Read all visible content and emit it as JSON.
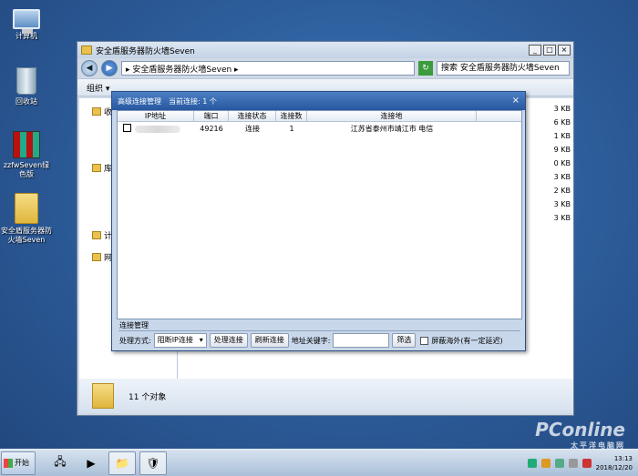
{
  "desktop": {
    "icons": [
      {
        "label": "计算机"
      },
      {
        "label": "回收站"
      },
      {
        "label": "zzfwSeven绿色版"
      },
      {
        "label": "安全盾服务器防火墙Seven"
      }
    ]
  },
  "explorer": {
    "title": "安全盾服务器防火墙Seven",
    "address": "▸ 安全盾服务器防火墙Seven ▸",
    "search_placeholder": "搜索 安全盾服务器防火墙Seven",
    "organize": "组织 ▾",
    "nav_items": [
      "收",
      "库",
      "计",
      "网"
    ],
    "sizes": [
      "3 KB",
      "6 KB",
      "1 KB",
      "9 KB",
      "0 KB",
      "3 KB",
      "2 KB",
      "3 KB",
      "3 KB"
    ],
    "status": "11 个对象"
  },
  "dialog": {
    "title": "高级连接管理",
    "connections_label": "当前连接: 1 个",
    "close": "×",
    "columns": [
      "IP地址",
      "端口",
      "连接状态",
      "连接数",
      "连接地"
    ],
    "rows": [
      {
        "port": "49216",
        "status": "连接",
        "count": "1",
        "location": "江苏省泰州市靖江市 电信"
      }
    ],
    "mgmt_label": "连接管理",
    "mode_label": "处理方式:",
    "mode_value": "阻断IP连接",
    "handle_button": "处理连接",
    "refresh_button": "刷新连接",
    "keyword_label": "地址关键字:",
    "filter_button": "筛选",
    "shield_label": "屏蔽海外(有一定延迟)"
  },
  "taskbar": {
    "start_label": "开始",
    "time": "13:13",
    "date": "2018/12/20"
  },
  "watermark": {
    "brand": "PConline",
    "sub": "太平洋电脑网"
  }
}
